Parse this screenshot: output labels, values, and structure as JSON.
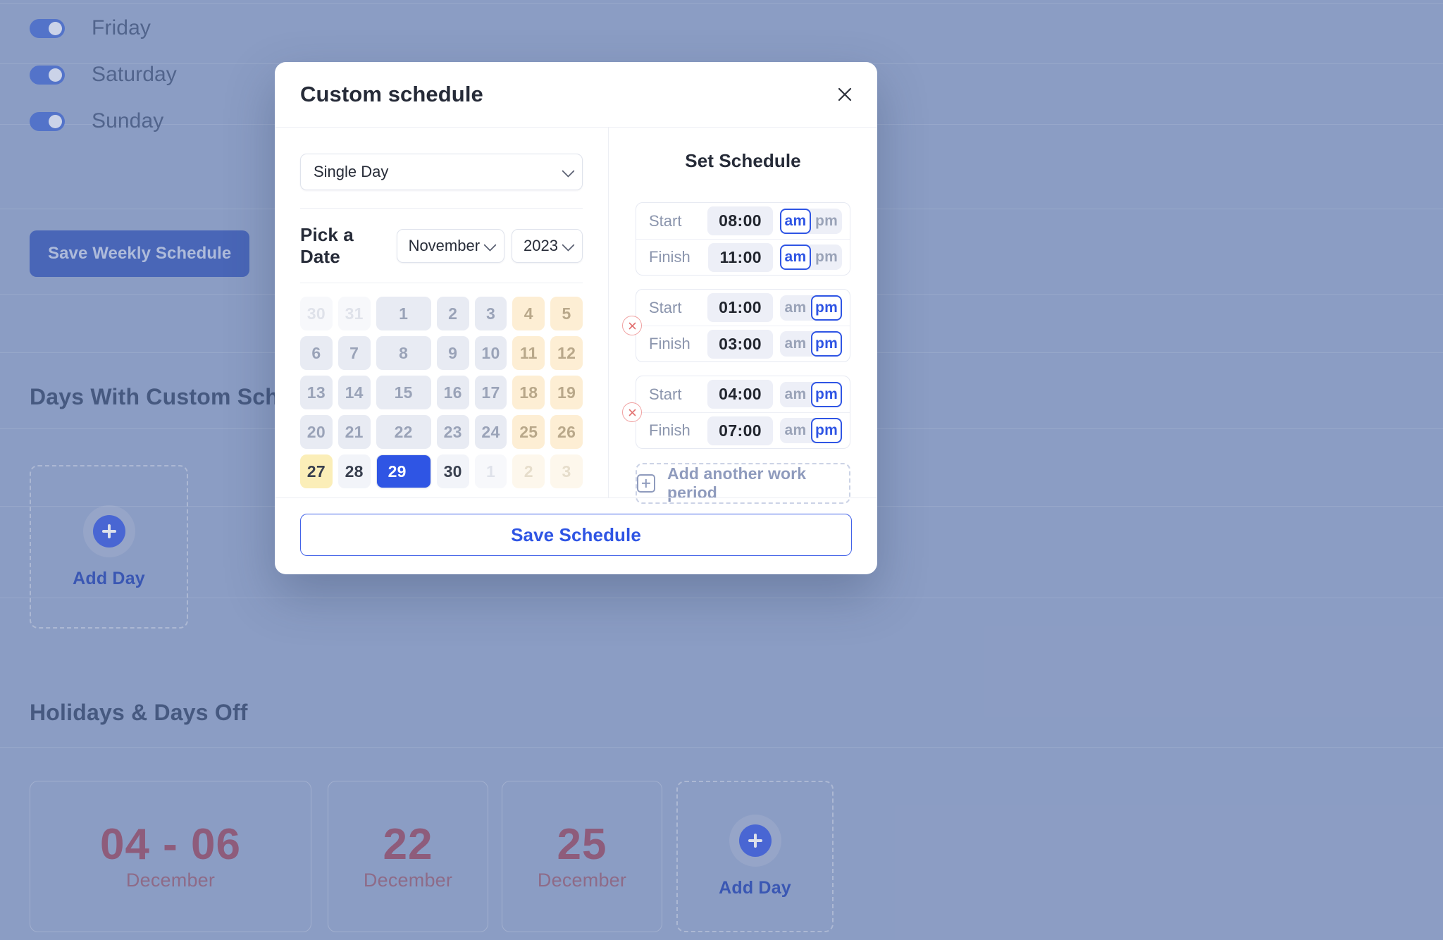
{
  "background": {
    "day_toggles": [
      {
        "label": "Friday",
        "on": true
      },
      {
        "label": "Saturday",
        "on": true
      },
      {
        "label": "Sunday",
        "on": true
      }
    ],
    "save_weekly_label": "Save Weekly Schedule",
    "custom_section_title": "Days With Custom Schedules",
    "holidays_section_title": "Holidays & Days Off",
    "add_day_label": "Add Day",
    "holidays": [
      {
        "day": "04 - 06",
        "month": "December"
      },
      {
        "day": "22",
        "month": "December"
      },
      {
        "day": "25",
        "month": "December"
      }
    ]
  },
  "modal": {
    "title": "Custom schedule",
    "close_icon": "close-icon",
    "mode_select": {
      "value": "Single Day",
      "chevron": "chevron-down-icon"
    },
    "pick_a_date_label": "Pick a Date",
    "month_select": {
      "value": "November",
      "chevron": "chevron-down-icon"
    },
    "year_select": {
      "value": "2023",
      "chevron": "chevron-down-icon"
    },
    "calendar": {
      "cells": [
        {
          "n": "30",
          "state": "out"
        },
        {
          "n": "31",
          "state": "out"
        },
        {
          "n": "1",
          "state": "wd"
        },
        {
          "n": "2",
          "state": "wd"
        },
        {
          "n": "3",
          "state": "wd"
        },
        {
          "n": "4",
          "state": "we"
        },
        {
          "n": "5",
          "state": "we"
        },
        {
          "n": "6",
          "state": "wd"
        },
        {
          "n": "7",
          "state": "wd"
        },
        {
          "n": "8",
          "state": "wd"
        },
        {
          "n": "9",
          "state": "wd"
        },
        {
          "n": "10",
          "state": "wd"
        },
        {
          "n": "11",
          "state": "we"
        },
        {
          "n": "12",
          "state": "we"
        },
        {
          "n": "13",
          "state": "wd"
        },
        {
          "n": "14",
          "state": "wd"
        },
        {
          "n": "15",
          "state": "wd"
        },
        {
          "n": "16",
          "state": "wd"
        },
        {
          "n": "17",
          "state": "wd"
        },
        {
          "n": "18",
          "state": "we"
        },
        {
          "n": "19",
          "state": "we"
        },
        {
          "n": "20",
          "state": "wd"
        },
        {
          "n": "21",
          "state": "wd"
        },
        {
          "n": "22",
          "state": "wd"
        },
        {
          "n": "23",
          "state": "wd"
        },
        {
          "n": "24",
          "state": "wd"
        },
        {
          "n": "25",
          "state": "we"
        },
        {
          "n": "26",
          "state": "we"
        },
        {
          "n": "27",
          "state": "today"
        },
        {
          "n": "28",
          "state": "near"
        },
        {
          "n": "29",
          "state": "sel"
        },
        {
          "n": "30",
          "state": "near"
        },
        {
          "n": "1",
          "state": "out"
        },
        {
          "n": "2",
          "state": "outwe"
        },
        {
          "n": "3",
          "state": "outwe"
        }
      ]
    },
    "set_schedule_title": "Set Schedule",
    "periods": [
      {
        "removable": false,
        "remove_icon": "close-circle-icon",
        "start": {
          "label": "Start",
          "time": "08:00",
          "am": "am",
          "pm": "pm",
          "selected": "am"
        },
        "finish": {
          "label": "Finish",
          "time": "11:00",
          "am": "am",
          "pm": "pm",
          "selected": "am"
        }
      },
      {
        "removable": true,
        "remove_icon": "close-circle-icon",
        "start": {
          "label": "Start",
          "time": "01:00",
          "am": "am",
          "pm": "pm",
          "selected": "pm"
        },
        "finish": {
          "label": "Finish",
          "time": "03:00",
          "am": "am",
          "pm": "pm",
          "selected": "pm"
        }
      },
      {
        "removable": true,
        "remove_icon": "close-circle-icon",
        "start": {
          "label": "Start",
          "time": "04:00",
          "am": "am",
          "pm": "pm",
          "selected": "pm"
        },
        "finish": {
          "label": "Finish",
          "time": "07:00",
          "am": "am",
          "pm": "pm",
          "selected": "pm"
        }
      }
    ],
    "add_period_label": "Add another work period",
    "add_period_icon": "plus-square-icon",
    "save_label": "Save Schedule"
  },
  "colors": {
    "accent_blue": "#2f55e4",
    "page_bg": "#97a8cd",
    "weekend_bg": "#fdeed4",
    "today_bg": "#fbeeb8",
    "holiday_text": "#9a5570",
    "remove_red": "#e2706f"
  }
}
